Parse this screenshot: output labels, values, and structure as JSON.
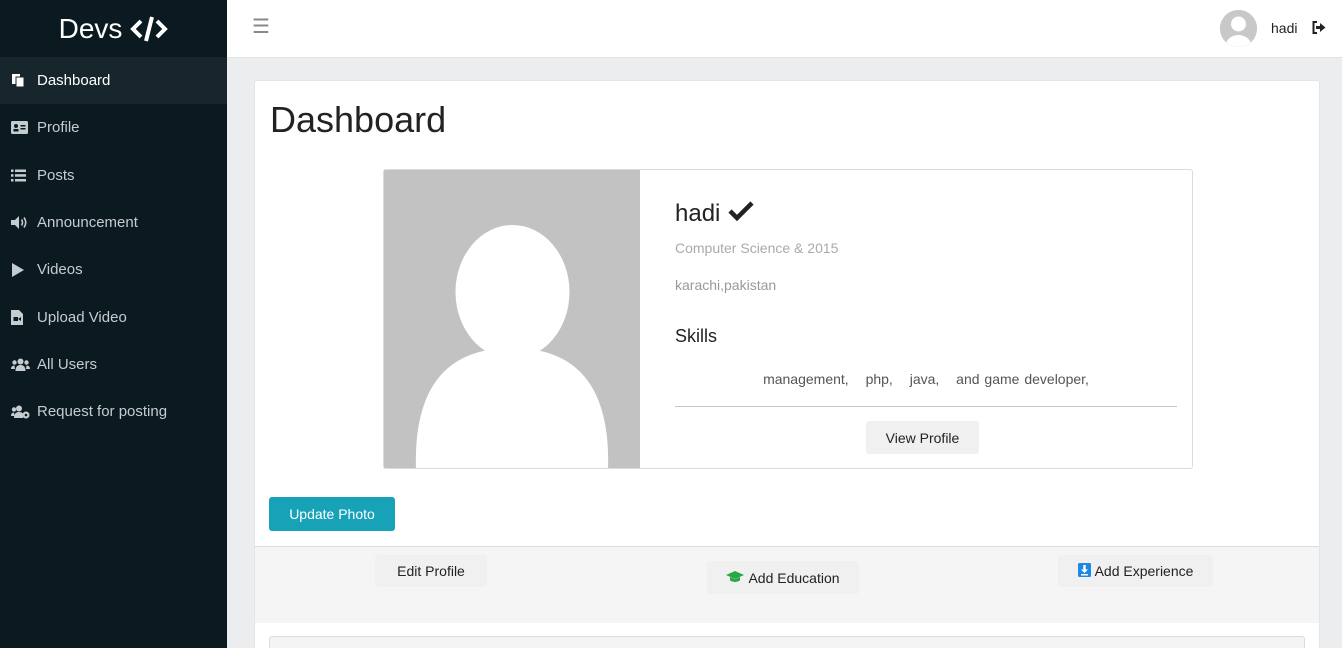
{
  "brand": {
    "name": "Devs",
    "icon": "code-icon"
  },
  "sidebar": {
    "items": [
      {
        "label": "Dashboard",
        "icon": "copy-icon",
        "active": true
      },
      {
        "label": "Profile",
        "icon": "id-card-icon",
        "active": false
      },
      {
        "label": "Posts",
        "icon": "list-icon",
        "active": false
      },
      {
        "label": "Announcement",
        "icon": "volume-icon",
        "active": false
      },
      {
        "label": "Videos",
        "icon": "play-icon",
        "active": false
      },
      {
        "label": "Upload Video",
        "icon": "file-video-icon",
        "active": false
      },
      {
        "label": "All Users",
        "icon": "users-icon",
        "active": false
      },
      {
        "label": "Request for posting",
        "icon": "users-cog-icon",
        "active": false
      }
    ]
  },
  "topbar": {
    "menu_icon": "hamburger-icon",
    "user_name": "hadi",
    "logout_icon": "sign-out-icon"
  },
  "main": {
    "title": "Dashboard",
    "profile": {
      "name": "hadi",
      "verified_icon": "check-icon",
      "subtitle": "Computer Science & 2015",
      "location": "karachi,pakistan",
      "skills_title": "Skills",
      "skills": [
        "management,",
        "php,",
        "java,",
        "and game developer,"
      ],
      "view_button": "View Profile"
    },
    "update_photo_button": "Update Photo",
    "actions": {
      "edit_profile": "Edit Profile",
      "add_education": "Add Education",
      "add_experience": "Add Experience"
    }
  },
  "colors": {
    "sidebar_bg": "#0b1a20",
    "active_item_bg": "#17262c",
    "primary": "#17a2b8",
    "education_icon": "#28a745",
    "experience_icon": "#1e88e5"
  }
}
